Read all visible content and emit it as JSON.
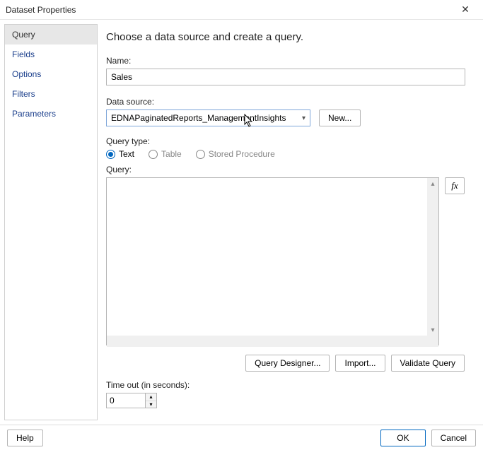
{
  "window": {
    "title": "Dataset Properties"
  },
  "sidebar": {
    "items": [
      {
        "label": "Query",
        "selected": true
      },
      {
        "label": "Fields",
        "selected": false
      },
      {
        "label": "Options",
        "selected": false
      },
      {
        "label": "Filters",
        "selected": false
      },
      {
        "label": "Parameters",
        "selected": false
      }
    ]
  },
  "main": {
    "heading": "Choose a data source and create a query.",
    "name_label": "Name:",
    "name_value": "Sales",
    "ds_label": "Data source:",
    "ds_selected": "EDNAPaginatedReports_ManagementInsights",
    "new_button": "New...",
    "qtype_label": "Query type:",
    "qtype_options": [
      {
        "label": "Text",
        "checked": true
      },
      {
        "label": "Table",
        "checked": false
      },
      {
        "label": "Stored Procedure",
        "checked": false
      }
    ],
    "query_label": "Query:",
    "query_value": "",
    "fx_label": "fx",
    "buttons": {
      "designer": "Query Designer...",
      "import": "Import...",
      "validate": "Validate Query"
    },
    "timeout_label": "Time out (in seconds):",
    "timeout_value": "0"
  },
  "footer": {
    "help": "Help",
    "ok": "OK",
    "cancel": "Cancel"
  }
}
